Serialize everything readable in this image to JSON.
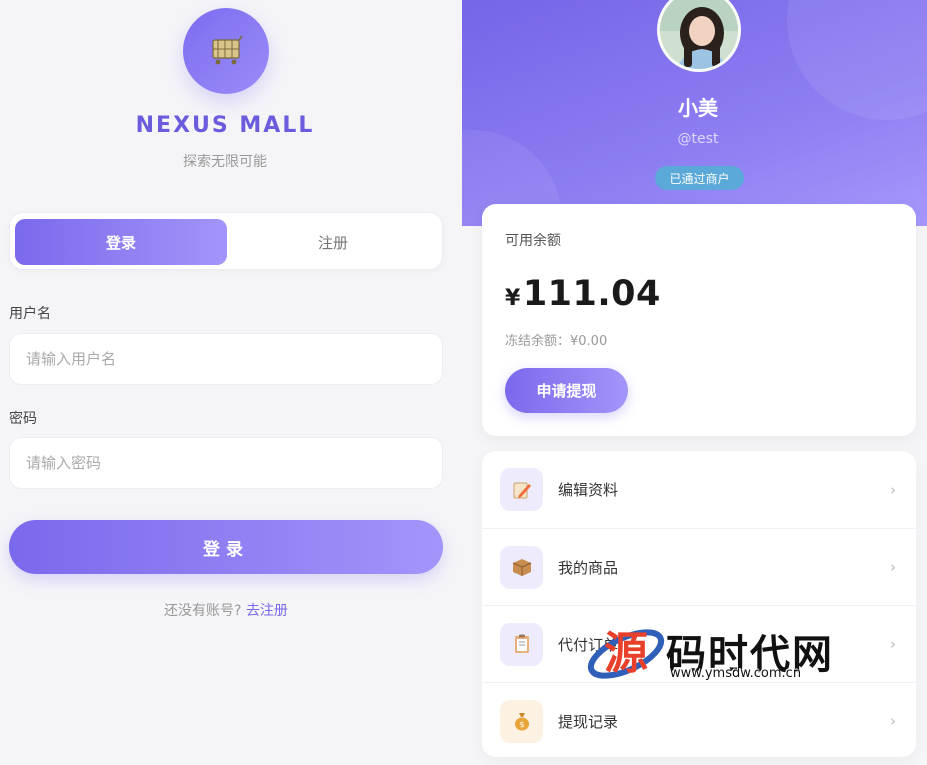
{
  "login": {
    "brand_title": "NEXUS MALL",
    "brand_subtitle": "探索无限可能",
    "tabs": [
      {
        "label": "登录",
        "active": true
      },
      {
        "label": "注册",
        "active": false
      }
    ],
    "username_label": "用户名",
    "username_placeholder": "请输入用户名",
    "password_label": "密码",
    "password_placeholder": "请输入密码",
    "submit_label": "登录",
    "register_prompt": "还没有账号?",
    "register_link": "去注册"
  },
  "profile": {
    "name": "小美",
    "handle": "@test",
    "badge": "已通过商户"
  },
  "balance": {
    "label": "可用余额",
    "currency": "¥",
    "amount": "111.04",
    "frozen": "冻结余额：¥0.00",
    "withdraw_label": "申请提现"
  },
  "menu": [
    {
      "label": "编辑资料",
      "icon": "edit-pencil-icon"
    },
    {
      "label": "我的商品",
      "icon": "package-box-icon"
    },
    {
      "label": "代付订单",
      "icon": "clipboard-icon"
    },
    {
      "label": "提现记录",
      "icon": "money-bag-icon"
    }
  ],
  "watermark": {
    "title": "码时代网",
    "url": "www.ymsdw.com.cn"
  },
  "colors": {
    "accent": "#7a69ec",
    "accent_light": "#a295fa",
    "badge": "#5aa9d8"
  }
}
